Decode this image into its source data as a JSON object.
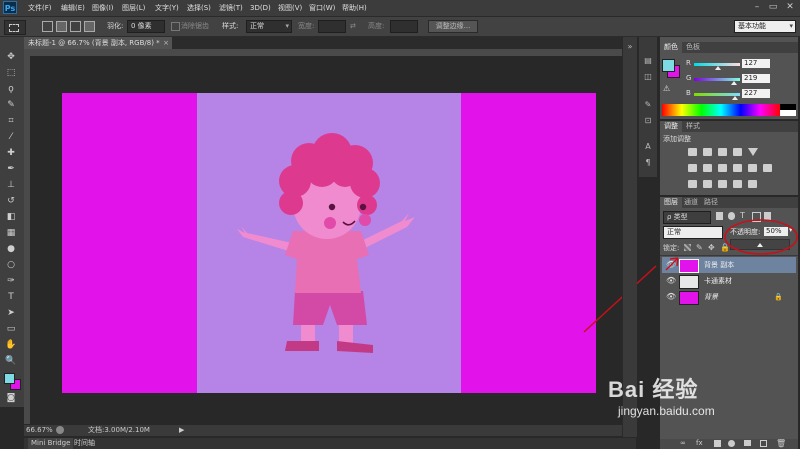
{
  "app": {
    "logo": "Ps"
  },
  "menu": [
    "文件(F)",
    "编辑(E)",
    "图像(I)",
    "图层(L)",
    "文字(Y)",
    "选择(S)",
    "滤镜(T)",
    "3D(D)",
    "视图(V)",
    "窗口(W)",
    "帮助(H)"
  ],
  "window_controls": {
    "minimize": "–",
    "restore": "▭",
    "close": "✕"
  },
  "options": {
    "feather_label": "羽化:",
    "feather_value": "0 像素",
    "antialias_label": "消除锯齿",
    "style_label": "样式:",
    "style_value": "正常",
    "width_label": "宽度:",
    "height_label": "高度:",
    "refine_button": "调整边缘...",
    "workspace": "基本功能"
  },
  "document": {
    "tab_title": "未标题-1 @ 66.7% (背景 副本, RGB/8) *",
    "tab_close": "×",
    "canvas_colors": {
      "magenta": "#e212ea",
      "lavender": "#b683e6"
    }
  },
  "status": {
    "zoom": "66.67%",
    "doc_info": "文档:3.00M/2.10M",
    "arrow": "▶"
  },
  "bottom_tabs": [
    "Mini Bridge",
    "时间轴"
  ],
  "color_panel": {
    "tabs": [
      "颜色",
      "色板"
    ],
    "channels": [
      {
        "label": "R",
        "value": "127",
        "level": 0.5
      },
      {
        "label": "G",
        "value": "219",
        "level": 0.86
      },
      {
        "label": "B",
        "value": "227",
        "level": 0.89
      }
    ],
    "fg_color": "#7fdbe3",
    "bg_color": "#e212ea"
  },
  "adjust_panel": {
    "tabs": [
      "调整",
      "样式"
    ],
    "heading": "添加调整"
  },
  "layers_panel": {
    "tabs": [
      "图层",
      "通道",
      "路径"
    ],
    "filter_label": "ρ 类型",
    "blend_mode": "正常",
    "opacity_label": "不透明度:",
    "opacity_value": "50%",
    "lock_label": "锁定:",
    "layers": [
      {
        "name": "背景 副本",
        "selected": true,
        "thumb": "#e212ea"
      },
      {
        "name": "卡通素材",
        "selected": false,
        "thumb": "#b683e6"
      },
      {
        "name": "背景",
        "selected": false,
        "thumb": "#e212ea",
        "locked": true
      }
    ]
  },
  "watermark": {
    "brand": "Bai 经验",
    "url": "jingyan.baidu.com"
  },
  "annotation_color": "#c8101a"
}
